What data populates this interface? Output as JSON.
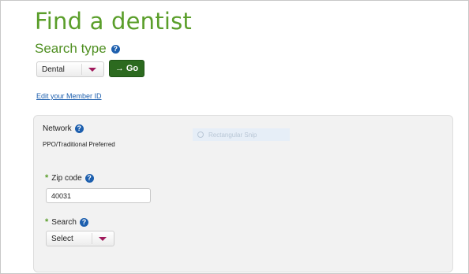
{
  "page": {
    "title": "Find a dentist"
  },
  "search_type": {
    "heading": "Search type",
    "help_icon": "?",
    "selected": "Dental",
    "go_label": "Go",
    "go_arrow": "→"
  },
  "member": {
    "edit_link": "Edit your Member ID"
  },
  "network": {
    "label": "Network",
    "help_icon": "?",
    "value": "PPO/Traditional Preferred"
  },
  "overlay": {
    "label": "Rectangular Snip"
  },
  "zip": {
    "required_mark": "*",
    "label": "Zip code",
    "help_icon": "?",
    "value": "40031"
  },
  "search": {
    "required_mark": "*",
    "label": "Search",
    "help_icon": "?",
    "selected": "Select"
  },
  "colors": {
    "brand_green": "#5a9e2a",
    "go_button": "#2c6a1f",
    "link_blue": "#1d5fae",
    "caret": "#a01a5c",
    "panel_bg": "#f2f2f2"
  }
}
